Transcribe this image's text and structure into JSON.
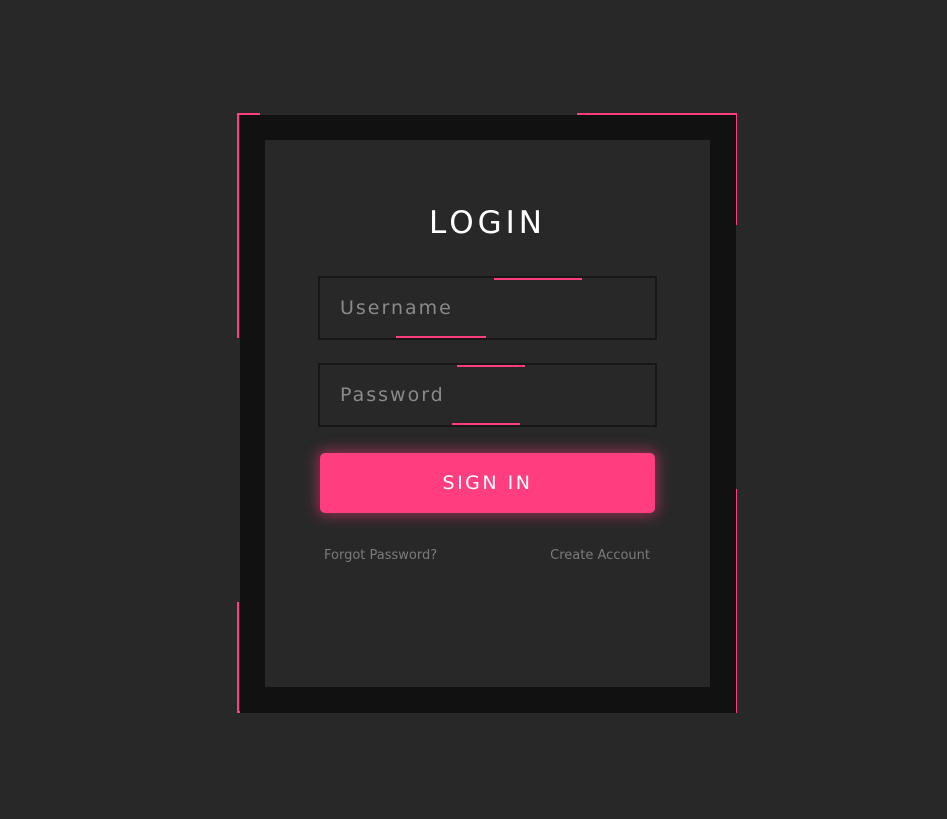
{
  "login": {
    "title": "LOGIN",
    "username": {
      "value": "",
      "placeholder": "Username"
    },
    "password": {
      "value": "",
      "placeholder": "Password"
    },
    "signin_label": "SIGN IN",
    "forgot_password_label": "Forgot Password?",
    "create_account_label": "Create Account"
  },
  "colors": {
    "accent": "#ff3d7f",
    "background": "#282828",
    "frame": "#111111",
    "field_border": "#171717"
  }
}
